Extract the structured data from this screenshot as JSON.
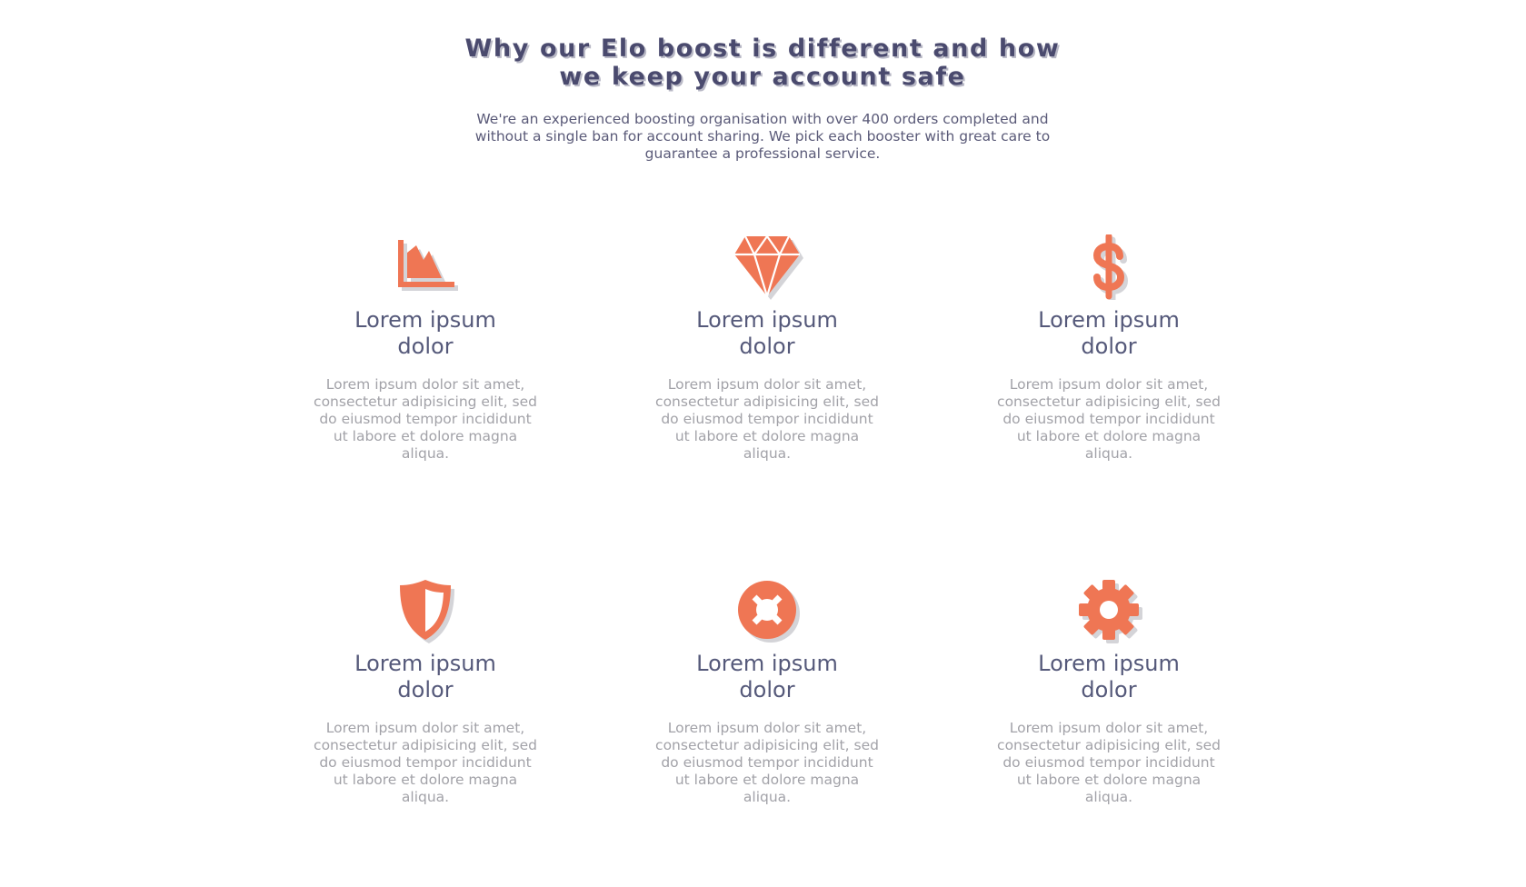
{
  "header": {
    "title": "Why our Elo boost is different and how we keep your account safe",
    "subtitle": "We're an experienced boosting organisation with over 400 orders completed and without a single ban for account sharing. We pick each booster with great care to guarantee a professional service."
  },
  "colors": {
    "accent": "#ef7654",
    "heading": "#4a4a6e",
    "heading_shadow": "#b9b9c6",
    "body_text": "#a2a2a8",
    "icon_shadow": "#d4d4d8"
  },
  "features": [
    {
      "icon": "area-chart-icon",
      "title": "Lorem ipsum dolor",
      "text": "Lorem ipsum dolor sit amet, consectetur adipisicing elit, sed do eiusmod tempor incididunt ut labore et dolore magna aliqua."
    },
    {
      "icon": "diamond-icon",
      "title": "Lorem ipsum dolor",
      "text": "Lorem ipsum dolor sit amet, consectetur adipisicing elit, sed do eiusmod tempor incididunt ut labore et dolore magna aliqua."
    },
    {
      "icon": "dollar-icon",
      "title": "Lorem ipsum dolor",
      "text": "Lorem ipsum dolor sit amet, consectetur adipisicing elit, sed do eiusmod tempor incididunt ut labore et dolore magna aliqua."
    },
    {
      "icon": "shield-icon",
      "title": "Lorem ipsum dolor",
      "text": "Lorem ipsum dolor sit amet, consectetur adipisicing elit, sed do eiusmod tempor incididunt ut labore et dolore magna aliqua."
    },
    {
      "icon": "life-ring-icon",
      "title": "Lorem ipsum dolor",
      "text": "Lorem ipsum dolor sit amet, consectetur adipisicing elit, sed do eiusmod tempor incididunt ut labore et dolore magna aliqua."
    },
    {
      "icon": "gear-icon",
      "title": "Lorem ipsum dolor",
      "text": "Lorem ipsum dolor sit amet, consectetur adipisicing elit, sed do eiusmod tempor incididunt ut labore et dolore magna aliqua."
    }
  ]
}
